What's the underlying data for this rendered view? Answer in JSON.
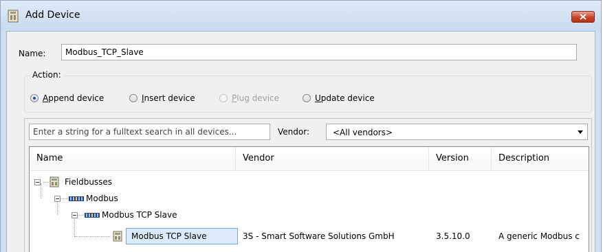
{
  "window": {
    "title": "Add Device",
    "icon": "device-icon",
    "close_icon": "close-icon"
  },
  "name": {
    "label": "Name:",
    "value": "Modbus_TCP_Slave"
  },
  "action": {
    "legend": "Action:",
    "options": [
      {
        "label": "Append device",
        "mnemonic": "A",
        "rest": "ppend device",
        "checked": true,
        "enabled": true
      },
      {
        "label": "Insert device",
        "mnemonic": "I",
        "rest": "nsert device",
        "checked": false,
        "enabled": true
      },
      {
        "label": "Plug device",
        "mnemonic": "P",
        "rest": "lug device",
        "checked": false,
        "enabled": false
      },
      {
        "label": "Update device",
        "mnemonic": "U",
        "rest": "pdate device",
        "checked": false,
        "enabled": true
      }
    ]
  },
  "search": {
    "placeholder": "Enter a string for a fulltext search in all devices..."
  },
  "vendor": {
    "label": "Vendor:",
    "selected": "<All vendors>"
  },
  "table": {
    "columns": [
      "Name",
      "Vendor",
      "Version",
      "Description"
    ],
    "rows": [
      {
        "name": "Fieldbusses",
        "vendor": "",
        "version": "",
        "description": ""
      },
      {
        "name": "Modbus",
        "vendor": "",
        "version": "",
        "description": ""
      },
      {
        "name": "Modbus TCP Slave",
        "vendor": "",
        "version": "",
        "description": ""
      },
      {
        "name": "Modbus TCP Slave",
        "vendor": "3S - Smart Software Solutions GmbH",
        "version": "3.5.10.0",
        "description": "A generic Modbus c"
      }
    ]
  },
  "colors": {
    "title_bg": "#cfdff0",
    "close": "#c8432a",
    "selection": "#dcebfc"
  }
}
